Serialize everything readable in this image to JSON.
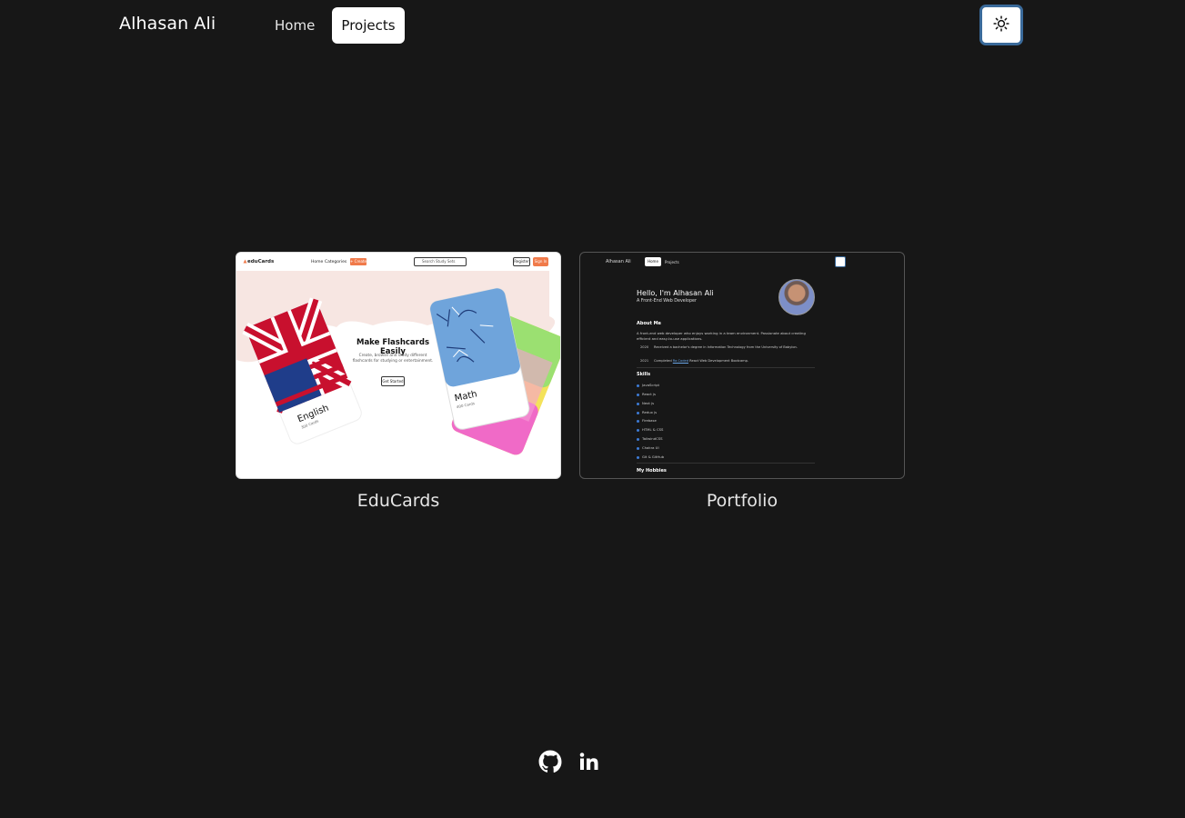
{
  "header": {
    "brand": "Alhasan Ali",
    "nav": {
      "home": "Home",
      "projects": "Projects"
    },
    "theme_toggle_icon": "sun-icon"
  },
  "projects": [
    {
      "title": "EduCards",
      "thumbnail": {
        "logo": "eduCards",
        "nav_home": "Home",
        "nav_categories": "Categories",
        "nav_create": "+ Create",
        "search_placeholder": "Search Study Sets",
        "register": "Register",
        "signin": "Sign In",
        "hero_title": "Make Flashcards Easily",
        "hero_sub": "Create, browse and study different flashcards for studying or entertainment.",
        "hero_button": "Get Started",
        "card_left_title": "English",
        "card_left_count": "300 Cards",
        "card_right_title": "Math",
        "card_right_count": "400 Cards"
      }
    },
    {
      "title": "Portfolio",
      "thumbnail": {
        "brand": "Alhasan Ali",
        "nav_home": "Home",
        "nav_projects": "Projects",
        "hello": "Hello, I'm Alhasan Ali",
        "subtitle": "A Front-End Web Developer",
        "about_title": "About Me",
        "about_text": "A front-end web developer who enjoys working in a team environment. Passionate about creating efficient and easy-to-use applications.",
        "timeline": [
          {
            "year": "2020",
            "text": "Received a bachelor's degree in Information Technology from the University of Babylon."
          },
          {
            "year": "2021",
            "text_before": "Completed ",
            "link": "Ra.Coded",
            "text_after": " React Web Development Bootcamp."
          }
        ],
        "skills_title": "Skills",
        "skills": [
          "JavaScript",
          "React js",
          "Next js",
          "Redux js",
          "Firebase",
          "HTML & CSS",
          "TailwindCSS",
          "Chakra UI",
          "Git & GitHub"
        ],
        "hobbies_title": "My Hobbies"
      }
    }
  ],
  "footer": {
    "icons": [
      "github-icon",
      "linkedin-icon"
    ]
  },
  "colors": {
    "background": "#171717",
    "text": "#ffffff",
    "accent_orange": "#f07a4a",
    "accent_blue": "#3d7bd6"
  }
}
